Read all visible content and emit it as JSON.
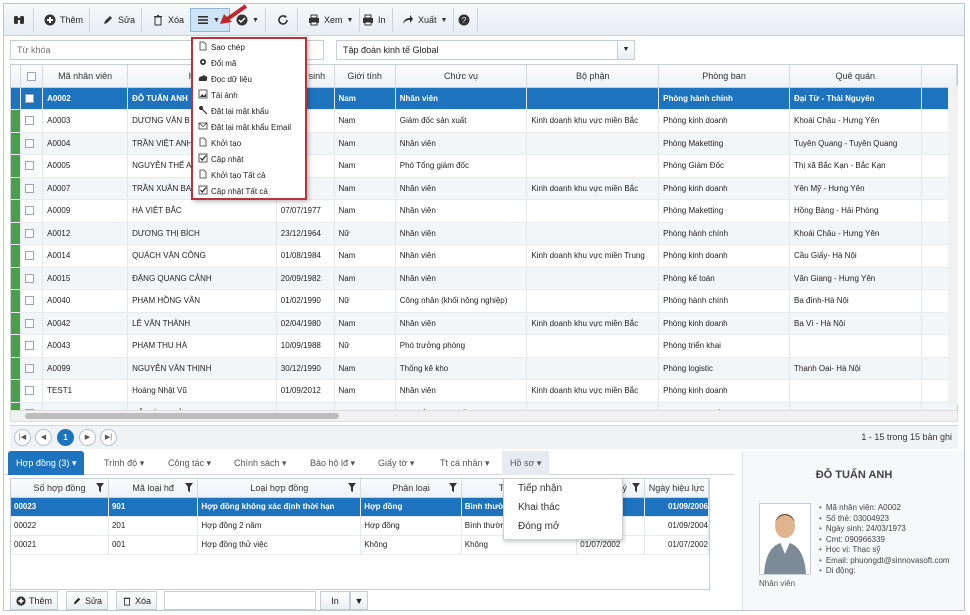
{
  "toolbar": {
    "add": "Thêm",
    "edit": "Sửa",
    "delete": "Xóa",
    "view": "Xem",
    "print": "In",
    "export": "Xuất"
  },
  "filter": {
    "keyword_placeholder": "Từ khóa",
    "org": "Tập đoàn kinh tế Global"
  },
  "menu": [
    "Sao chép",
    "Đổi mã",
    "Đọc dữ liệu",
    "Tải ảnh",
    "Đặt lại mật khẩu",
    "Đặt lại mật khẩu Email",
    "Khởi tạo",
    "Cập nhật",
    "Khởi tạo Tất cả",
    "Cập nhật Tất cả"
  ],
  "grid": {
    "headers": [
      "Mã nhân viên",
      "Họ tên",
      "Ngày sinh",
      "Giới tính",
      "Chức vụ",
      "Bộ phận",
      "Phòng ban",
      "Quê quán"
    ],
    "rows": [
      [
        "A0002",
        "ĐỖ TUẤN ANH",
        "973",
        "Nam",
        "Nhân viên",
        "",
        "Phòng hành chính",
        "Đại Từ - Thái Nguyên"
      ],
      [
        "A0003",
        "DƯƠNG VĂN B",
        "988",
        "Nam",
        "Giám đốc sản xuất",
        "Kinh doanh khu vực miền Bắc",
        "Phòng kinh doanh",
        "Khoái Châu - Hưng Yên"
      ],
      [
        "A0004",
        "TRẦN VIỆT ANH",
        "976",
        "Nam",
        "Nhân viên",
        "",
        "Phòng Maketting",
        "Tuyên Quang - Tuyên Quang"
      ],
      [
        "A0005",
        "NGUYỄN THẾ A",
        "983",
        "Nam",
        "Phó Tổng giám đốc",
        "",
        "Phòng Giám Đốc",
        "Thị xã Bắc Kạn - Bắc Kạn"
      ],
      [
        "A0007",
        "TRẦN XUÂN BA",
        "987",
        "Nam",
        "Nhân viên",
        "Kinh doanh khu vực miền Bắc",
        "Phòng kinh doanh",
        "Yên Mỹ - Hưng Yên"
      ],
      [
        "A0009",
        "HÀ VIỆT BẮC",
        "07/07/1977",
        "Nam",
        "Nhân viên",
        "",
        "Phòng Maketting",
        "Hồng Bàng - Hải Phòng"
      ],
      [
        "A0012",
        "DƯƠNG THỊ BÍCH",
        "23/12/1964",
        "Nữ",
        "Nhân viên",
        "",
        "Phòng hành chính",
        "Khoái Châu - Hưng Yên"
      ],
      [
        "A0014",
        "QUÁCH VĂN CÔNG",
        "01/08/1984",
        "Nam",
        "Nhân viên",
        "Kinh doanh khu vực miền Trung",
        "Phòng kinh doanh",
        "Cầu Giấy- Hà Nội"
      ],
      [
        "A0015",
        "ĐẶNG QUANG CẢNH",
        "20/09/1982",
        "Nam",
        "Nhân viên",
        "",
        "Phòng kế toán",
        "Văn Giang - Hưng Yên"
      ],
      [
        "A0040",
        "PHẠM HỒNG VÂN",
        "01/02/1990",
        "Nữ",
        "Công nhân (khối nông nghiệp)",
        "",
        "Phòng hành chính",
        "Ba đình-Hà Nội"
      ],
      [
        "A0042",
        "LÊ VĂN THÀNH",
        "02/04/1980",
        "Nam",
        "Nhân viên",
        "Kinh doanh khu vực miền Bắc",
        "Phòng kinh doanh",
        "Ba Vì - Hà Nội"
      ],
      [
        "A0043",
        "PHẠM THU HÀ",
        "10/09/1988",
        "Nữ",
        "Phó trưởng phòng",
        "",
        "Phòng triển khai",
        ""
      ],
      [
        "A0099",
        "NGUYỄN VĂN THỊNH",
        "30/12/1990",
        "Nam",
        "Thống kê kho",
        "",
        "Phòng logistic",
        "Thanh Oai- Hà Nội"
      ],
      [
        "TEST1",
        "Hoàng Nhật Vũ",
        "01/09/2012",
        "Nam",
        "Nhân viên",
        "Kinh doanh khu vực miền Bắc",
        "Phòng kinh doanh",
        ""
      ],
      [
        "thanh1",
        "ĐỖ ĐỨC THẢO",
        "30/12/1976",
        "Nam",
        "Phó Tổng giám đốc",
        "",
        "Phòng Giám Đốc",
        "Xuân Trường - Nam Định"
      ]
    ]
  },
  "pager": {
    "page": "1",
    "info": "1 - 15 trong 15 bản ghi"
  },
  "tabs": [
    "Hợp đồng (3)",
    "Trình độ",
    "Công tác",
    "Chính sách",
    "Bảo hộ lđ",
    "Giấy tờ",
    "Tt cá nhân",
    "Hồ sơ"
  ],
  "detail": {
    "headers": [
      "Số hợp đồng",
      "Mã loại hđ",
      "Loại hợp đồng",
      "Phân loại",
      "Trạng thái",
      "Ngày ký",
      "Ngày hiệu lực"
    ],
    "rows": [
      [
        "00023",
        "901",
        "Hợp đồng không xác định thời hạn",
        "Hợp đồng",
        "Bình thường",
        "",
        "01/09/2006"
      ],
      [
        "00022",
        "201",
        "Hợp đồng 2 năm",
        "Hợp đồng",
        "Bình thường",
        "",
        "01/09/2004"
      ],
      [
        "00021",
        "001",
        "Hợp đồng thử việc",
        "Không",
        "Không",
        "01/07/2002",
        "01/07/2002"
      ]
    ]
  },
  "popup": [
    "Tiếp nhận",
    "Khai thác",
    "Đóng mở"
  ],
  "bottom": {
    "add": "Thêm",
    "edit": "Sửa",
    "delete": "Xóa",
    "print": "In"
  },
  "profile": {
    "name": "ĐỖ TUẤN ANH",
    "role": "Nhân viên",
    "info": [
      "Mã nhân viên: A0002",
      "Số thẻ: 03004923",
      "Ngày sinh: 24/03/1973",
      "Cmt: 090966339",
      "Học vị: Thạc sỹ",
      "Email: phuongdt@sinnovasoft.com",
      "Di động:"
    ]
  }
}
